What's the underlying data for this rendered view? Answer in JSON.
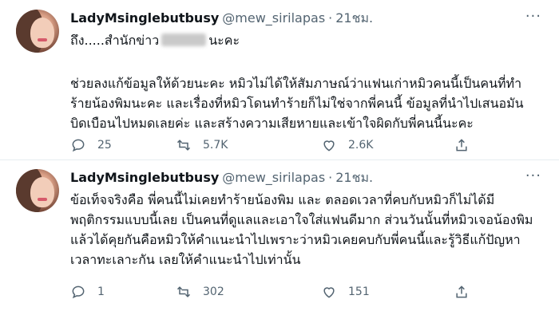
{
  "tweets": [
    {
      "display_name": "LadyMsinglebutbusy",
      "handle": "@mew_sirilapas",
      "separator": "·",
      "time": "21ชม.",
      "more": "···",
      "line1_before": "ถึง.....สำนักข่าว",
      "line1_after": "นะคะ",
      "paragraph": "ช่วยลงแก้ข้อมูลให้ด้วยนะคะ หมิวไม่ได้ให้สัมภาษณ์ว่าแฟนเก่าหมิวคนนี้เป็นคนที่ทำร้ายน้องพิมนะคะ และเรื่องที่หมิวโดนทำร้ายก็ไม่ใช่จากพี่คนนี้ ข้อมูลที่นำไปเสนอมันบิดเบือนไปหมดเลยค่ะ และสร้างความเสียหายและเข้าใจผิดกับพี่คนนี้นะคะ",
      "replies": "25",
      "retweets": "5.7K",
      "likes": "2.6K"
    },
    {
      "display_name": "LadyMsinglebutbusy",
      "handle": "@mew_sirilapas",
      "separator": "·",
      "time": "21ชม.",
      "more": "···",
      "paragraph": "ข้อเท็จจริงคือ พี่คนนี้ไม่เคยทำร้ายน้องพิม และ ตลอดเวลาที่คบกับหมิวก็ไม่ได้มีพฤติกรรมแบบนี้เลย เป็นคนที่ดูแลและเอาใจใส่แฟนดีมาก ส่วนวันนั้นที่หมิวเจอน้องพิมแล้วได้คุยกันคือหมิวให้คำแนะนำไปเพราะว่าหมิวเคยคบกับพี่คนนี้และรู้วิธีแก้ปัญหาเวลาทะเลาะกัน เลยให้คำแนะนำไปเท่านั้น",
      "replies": "1",
      "retweets": "302",
      "likes": "151"
    }
  ],
  "icons": {
    "reply": "speech-bubble-icon",
    "retweet": "retweet-arrows-icon",
    "like": "heart-icon",
    "share": "share-upload-icon"
  },
  "colors": {
    "text": "#0f1419",
    "secondary": "#536471",
    "divider": "#e6ecf0"
  }
}
